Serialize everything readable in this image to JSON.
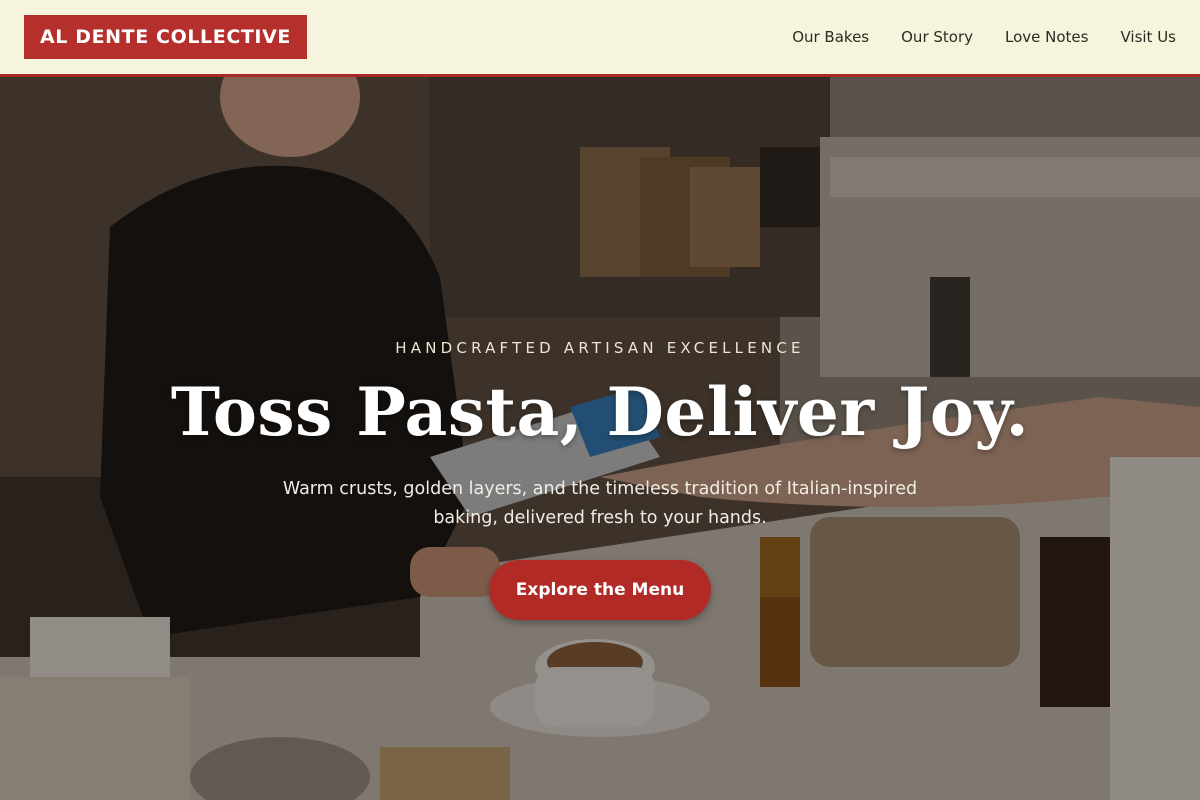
{
  "brand": {
    "logo_text": "AL DENTE COLLECTIVE"
  },
  "nav": {
    "items": [
      {
        "label": "Our Bakes"
      },
      {
        "label": "Our Story"
      },
      {
        "label": "Love Notes"
      },
      {
        "label": "Visit Us"
      }
    ]
  },
  "hero": {
    "eyebrow": "HANDCRAFTED ARTISAN EXCELLENCE",
    "headline": "Toss Pasta, Deliver Joy.",
    "subtext": "Warm crusts, golden layers, and the timeless tradition of Italian-inspired baking, delivered fresh to your hands.",
    "cta_label": "Explore the Menu",
    "background_description_icon": "cafe-counter-photo"
  },
  "colors": {
    "header_bg": "#f6f4dc",
    "brand_red": "#b5302c",
    "nav_text": "#2e2a24",
    "cta_bg": "#b12a26"
  }
}
